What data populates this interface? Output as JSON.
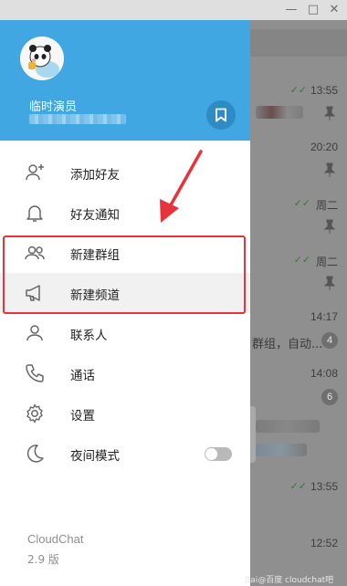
{
  "window": {
    "minimize_glyph": "—",
    "maximize_glyph": "□",
    "close_glyph": "✕"
  },
  "profile": {
    "name": "临时演员"
  },
  "menu": [
    {
      "label": "添加好友",
      "icon": "add-friend-icon"
    },
    {
      "label": "好友通知",
      "icon": "bell-icon"
    },
    {
      "label": "新建群组",
      "icon": "group-icon"
    },
    {
      "label": "新建频道",
      "icon": "megaphone-icon"
    },
    {
      "label": "联系人",
      "icon": "person-icon"
    },
    {
      "label": "通话",
      "icon": "phone-icon"
    },
    {
      "label": "设置",
      "icon": "gear-icon"
    },
    {
      "label": "夜间模式",
      "icon": "moon-icon",
      "toggle_on": false
    }
  ],
  "footer": {
    "app_name": "CloudChat",
    "version": "2.9 版"
  },
  "chats": [
    {
      "time": "13:55",
      "check": "✓✓"
    },
    {
      "time": "20:20"
    },
    {
      "time": "周二",
      "check": "✓✓"
    },
    {
      "time": "周二",
      "check": "✓✓"
    },
    {
      "time": "14:17",
      "snippet": "群组，自动...",
      "badge": "4"
    },
    {
      "time": "14:08",
      "badge": "6"
    },
    {
      "time": "13:55",
      "check": "✓✓"
    },
    {
      "time": "12:52"
    }
  ],
  "watermark": "Bai@百度  cloudchat吧",
  "colors": {
    "header_blue": "#40a7e3",
    "annotation_red": "#e8323c",
    "highlight_gray": "#f1f1f1"
  }
}
